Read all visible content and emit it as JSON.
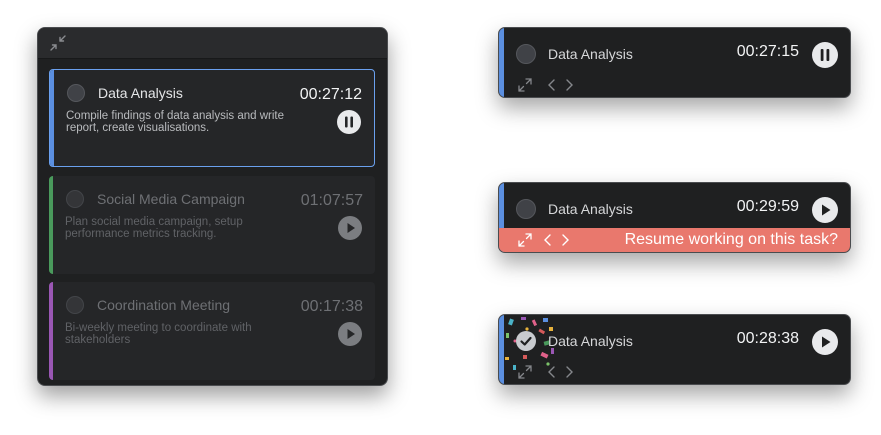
{
  "colors": {
    "accent_blue": "#5b8fe0",
    "accent_green": "#4a9a5c",
    "accent_purple": "#9a57b4",
    "alert_bg": "#e9786d",
    "active_border": "#6aa0ee"
  },
  "main_panel": {
    "collapse_icon": "collapse-icon",
    "tasks": [
      {
        "title": "Data Analysis",
        "description": "Compile findings of data analysis and write report, create visualisations.",
        "time": "00:27:12",
        "state": "running",
        "action_icon": "pause-icon"
      },
      {
        "title": "Social Media Campaign",
        "description": "Plan social media campaign, setup performance metrics tracking.",
        "time": "01:07:57",
        "state": "paused",
        "action_icon": "play-icon"
      },
      {
        "title": "Coordination Meeting",
        "description": "Bi-weekly meeting to coordinate with stakeholders",
        "time": "00:17:38",
        "state": "paused",
        "action_icon": "play-icon"
      }
    ]
  },
  "mini_widgets": [
    {
      "title": "Data Analysis",
      "time": "00:27:15",
      "action_icon": "pause-icon"
    },
    {
      "title": "Data Analysis",
      "time": "00:29:59",
      "action_icon": "play-icon",
      "alert_text": "Resume working on this task?"
    },
    {
      "title": "Data Analysis",
      "time": "00:28:38",
      "action_icon": "play-icon",
      "completed": true
    }
  ]
}
